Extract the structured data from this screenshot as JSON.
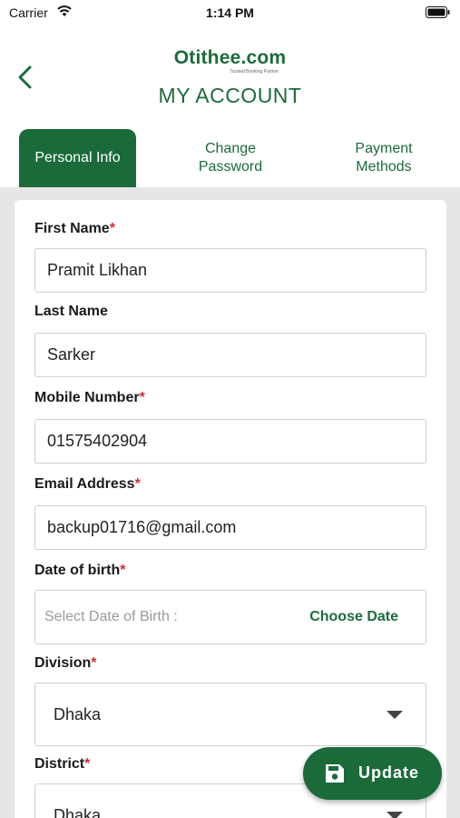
{
  "status_bar": {
    "carrier": "Carrier",
    "time": "1:14 PM"
  },
  "header": {
    "logo_text": "Otithee.com",
    "logo_tagline": "Trusted Booking Partner",
    "title": "MY ACCOUNT"
  },
  "tabs": [
    {
      "label": "Personal Info",
      "active": true
    },
    {
      "label": "Change\nPassword",
      "active": false
    },
    {
      "label": "Payment\nMethods",
      "active": false
    }
  ],
  "form": {
    "first_name": {
      "label": "First Name",
      "required": "*",
      "value": "Pramit Likhan"
    },
    "last_name": {
      "label": "Last Name",
      "value": "Sarker"
    },
    "mobile": {
      "label": "Mobile Number",
      "required": "*",
      "value": "01575402904"
    },
    "email": {
      "label": "Email Address",
      "required": "*",
      "value": "backup01716@gmail.com"
    },
    "dob": {
      "label": "Date of birth",
      "required": "*",
      "placeholder": "Select Date of Birth :",
      "action": "Choose Date"
    },
    "division": {
      "label": "Division",
      "required": "*",
      "value": "Dhaka"
    },
    "district": {
      "label": "District",
      "required": "*",
      "value": "Dhaka"
    }
  },
  "update_button": {
    "label": "Update",
    "icon": "save-icon"
  },
  "colors": {
    "brand": "#1b6b3a",
    "required": "#d32f2f",
    "background": "#e6e6e6"
  }
}
